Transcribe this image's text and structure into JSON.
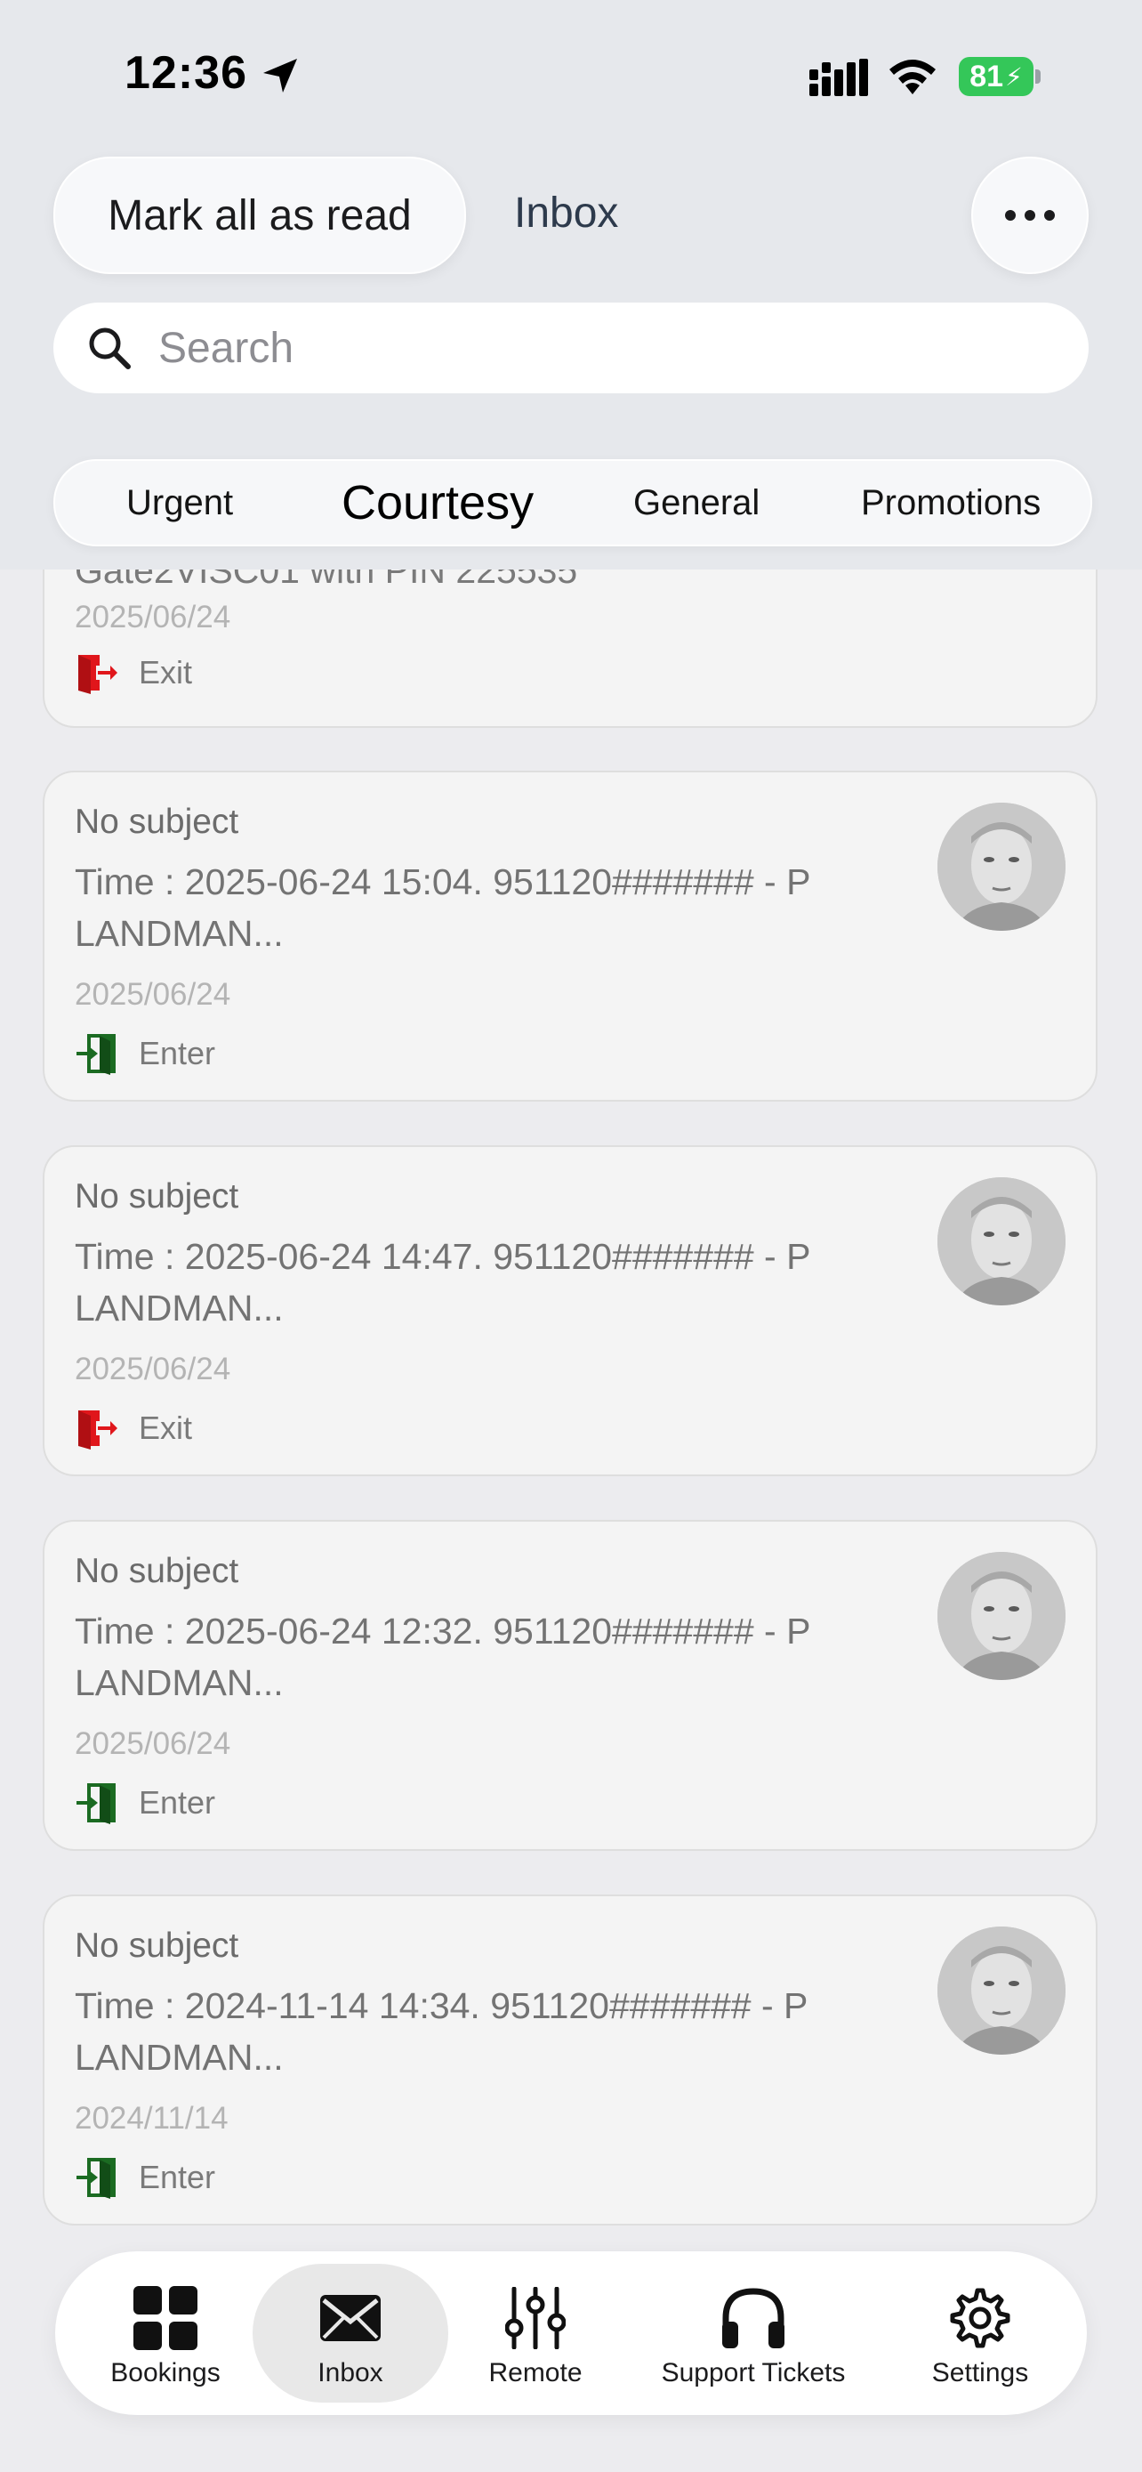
{
  "status_bar": {
    "time": "12:36",
    "battery": "81"
  },
  "header": {
    "mark_all_read_label": "Mark all as read",
    "title": "Inbox",
    "more_icon": "ellipsis-icon"
  },
  "search": {
    "placeholder": "Search",
    "value": ""
  },
  "tabs": [
    {
      "label": "Urgent",
      "selected": false
    },
    {
      "label": "Courtesy",
      "selected": true
    },
    {
      "label": "General",
      "selected": false
    },
    {
      "label": "Promotions",
      "selected": false
    }
  ],
  "messages": [
    {
      "subject": "",
      "preview": "Gate2VISC01 with PIN 225535",
      "date": "2025/06/24",
      "action": "Exit",
      "action_color": "#e0161b"
    },
    {
      "subject": "No subject",
      "preview": "Time : 2025-06-24 15:04. 951120####### - P LANDMAN...",
      "date": "2025/06/24",
      "action": "Enter",
      "action_color": "#1b6b22"
    },
    {
      "subject": "No subject",
      "preview": "Time : 2025-06-24 14:47. 951120####### - P LANDMAN...",
      "date": "2025/06/24",
      "action": "Exit",
      "action_color": "#e0161b"
    },
    {
      "subject": "No subject",
      "preview": "Time : 2025-06-24 12:32. 951120####### - P LANDMAN...",
      "date": "2025/06/24",
      "action": "Enter",
      "action_color": "#1b6b22"
    },
    {
      "subject": "No subject",
      "preview": "Time : 2024-11-14 14:34. 951120####### - P LANDMAN...",
      "date": "2024/11/14",
      "action": "Enter",
      "action_color": "#1b6b22"
    }
  ],
  "bottom_nav": [
    {
      "label": "Bookings",
      "icon": "grid-icon",
      "active": false
    },
    {
      "label": "Inbox",
      "icon": "envelope-icon",
      "active": true
    },
    {
      "label": "Remote",
      "icon": "sliders-icon",
      "active": false
    },
    {
      "label": "Support Tickets",
      "icon": "headphones-icon",
      "active": false
    },
    {
      "label": "Settings",
      "icon": "gear-icon",
      "active": false
    }
  ],
  "colors": {
    "exit": "#e0161b",
    "enter": "#1b6b22",
    "battery": "#34c759"
  }
}
